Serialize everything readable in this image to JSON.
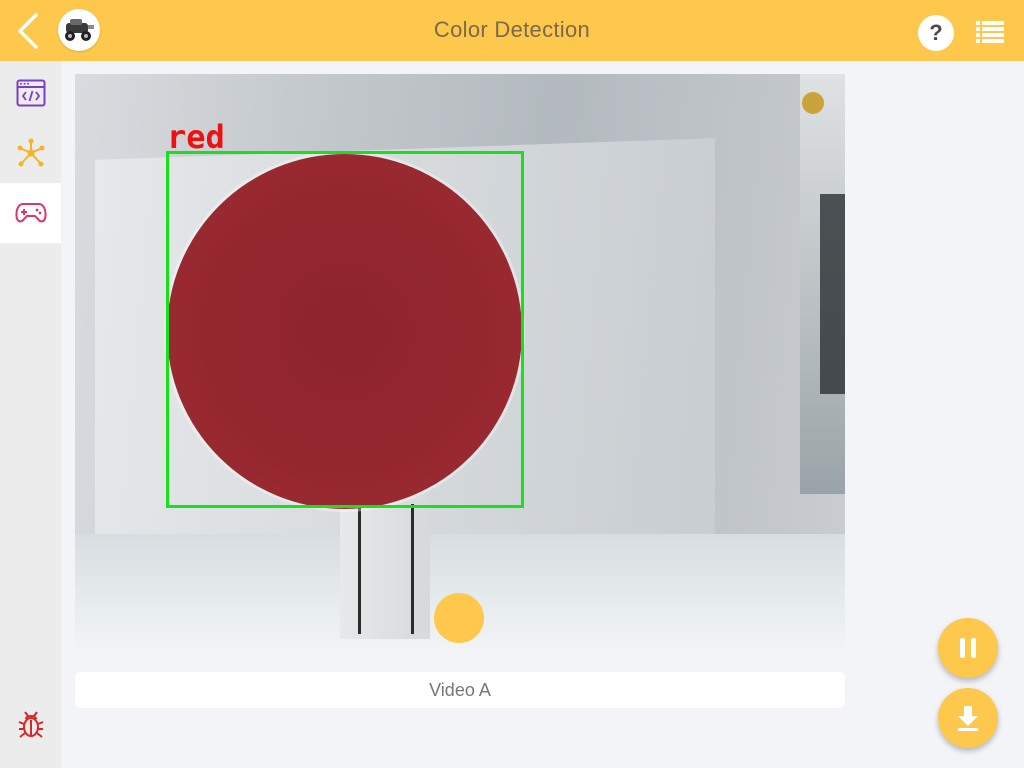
{
  "header": {
    "title": "Color Detection",
    "help_label": "?",
    "icons": {
      "back": "chevron-left-icon",
      "logo": "robot-car-logo",
      "menu": "list-menu-icon"
    }
  },
  "sidebar": {
    "items": [
      {
        "icon": "code-window-icon",
        "active": false
      },
      {
        "icon": "node-graph-icon",
        "active": false
      },
      {
        "icon": "gamepad-icon",
        "active": true
      }
    ],
    "bottom_icon": "bug-icon"
  },
  "video": {
    "detection_label": "red",
    "caption": "Video A"
  },
  "fabs": {
    "pause_icon": "pause-icon",
    "download_icon": "download-icon"
  },
  "colors": {
    "accent": "#fec84c",
    "detect_box": "#16e21a",
    "detect_label": "#ee1111",
    "sidebar_active_icon": "#e0356b",
    "bug_icon": "#d9262a"
  }
}
